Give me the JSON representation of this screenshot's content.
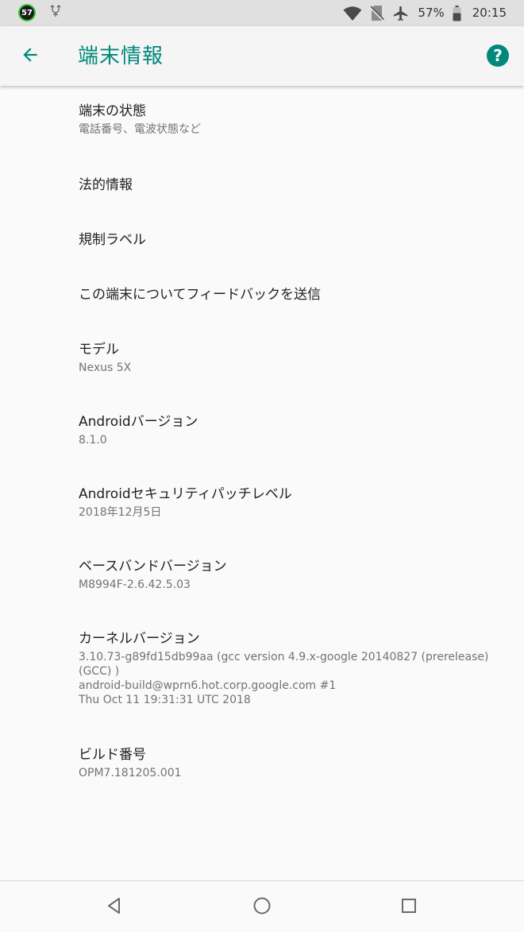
{
  "status_bar": {
    "notification_count": "57",
    "battery_percent": "57%",
    "time": "20:15",
    "icons": [
      "notification-badge-icon",
      "usb-debug-icon",
      "wifi-icon",
      "no-sim-icon",
      "airplane-icon",
      "battery-icon"
    ]
  },
  "app_bar": {
    "title": "端末情報",
    "back_icon": "arrow-back-icon",
    "help_icon": "help-icon",
    "help_glyph": "?"
  },
  "items": [
    {
      "title": "端末の状態",
      "summary": "電話番号、電波状態など"
    },
    {
      "title": "法的情報"
    },
    {
      "title": "規制ラベル"
    },
    {
      "title": "この端末についてフィードバックを送信"
    },
    {
      "title": "モデル",
      "summary": "Nexus 5X"
    },
    {
      "title": "Androidバージョン",
      "summary": "8.1.0"
    },
    {
      "title": "Androidセキュリティパッチレベル",
      "summary": "2018年12月5日"
    },
    {
      "title": "ベースバンドバージョン",
      "summary": "M8994F-2.6.42.5.03"
    },
    {
      "title": "カーネルバージョン",
      "summary_lines": [
        "3.10.73-g89fd15db99aa (gcc version 4.9.x-google 20140827 (prerelease)",
        "(GCC) )",
        "android-build@wprn6.hot.corp.google.com #1",
        "Thu Oct 11 19:31:31 UTC 2018"
      ]
    },
    {
      "title": "ビルド番号",
      "summary": "OPM7.181205.001"
    }
  ],
  "nav_bar": {
    "icons": [
      "nav-back-icon",
      "nav-home-icon",
      "nav-recents-icon"
    ]
  },
  "colors": {
    "accent": "#00897b",
    "status_bar_bg": "#e0e0e0",
    "background": "#fafafa",
    "primary_text": "#212121",
    "secondary_text": "#737373"
  }
}
